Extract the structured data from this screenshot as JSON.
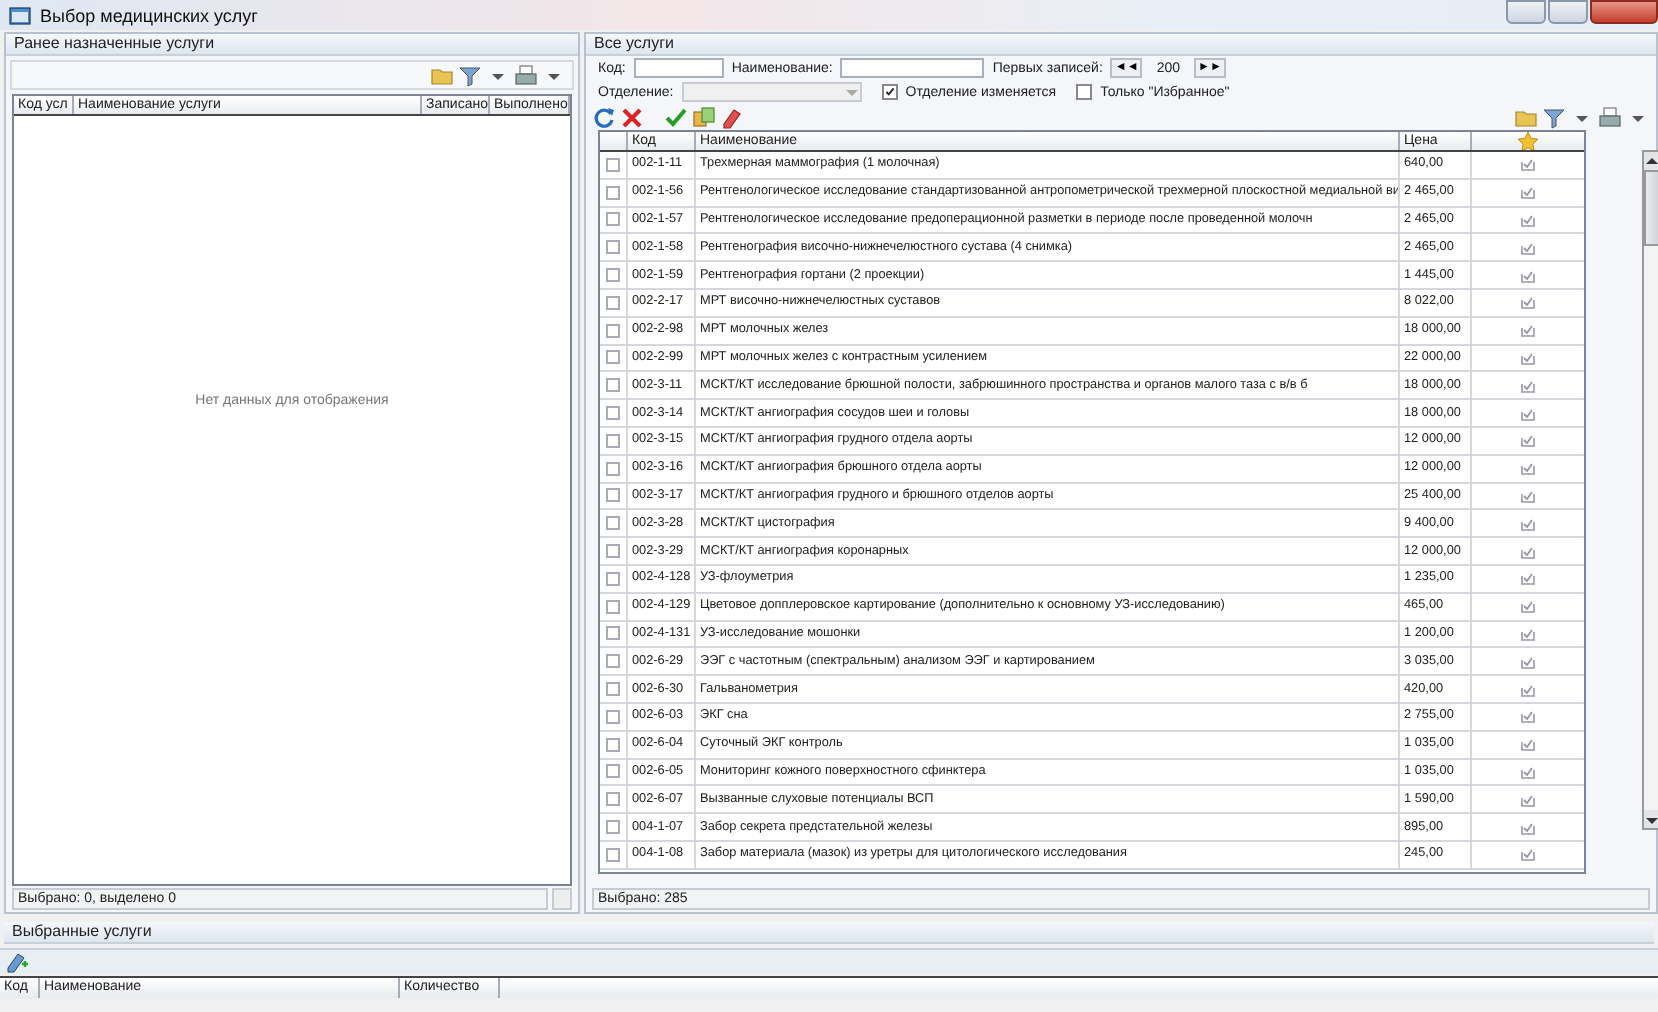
{
  "window": {
    "title": "Выбор медицинских услуг"
  },
  "left_panel": {
    "title": "Ранее назначенные услуги",
    "columns": [
      "Код усл",
      "Наименование услуги",
      "Записано",
      "Выполнено"
    ],
    "empty_text": "Нет данных для отображения",
    "status": "Выбрано: 0, выделено 0"
  },
  "services_panel": {
    "title": "Все услуги",
    "filters": {
      "code_label": "Код:",
      "name_label": "Наименование:",
      "limit_label": "Первых записей:",
      "first_button": "◄◄",
      "limit_value": "200",
      "last_button": "►►",
      "department_label": "Отделение:",
      "department_disabled": true
    },
    "checkboxes": [
      {
        "label": "Отделение изменяется",
        "checked": true
      },
      {
        "label": "Только \"Избранное\"",
        "checked": false
      }
    ],
    "columns": [
      "Код",
      "Наименование",
      "Цена"
    ],
    "rows": [
      {
        "code": "002-1-11",
        "name": "Трехмерная маммография (1 молочная)",
        "price": "640,00",
        "checked": false
      },
      {
        "code": "002-1-56",
        "name": "Рентгенологическое исследование стандартизованной антропометрической трехмерной плоскостной медиальной ви",
        "price": "2 465,00",
        "checked": false
      },
      {
        "code": "002-1-57",
        "name": "Рентгенологическое исследование предоперационной разметки в периоде после проведенной молочн",
        "price": "2 465,00",
        "checked": false
      },
      {
        "code": "002-1-58",
        "name": "Рентгенография височно-нижнечелюстного сустава (4 снимка)",
        "price": "2 465,00",
        "checked": false
      },
      {
        "code": "002-1-59",
        "name": "Рентгенография гортани (2 проекции)",
        "price": "1 445,00",
        "checked": false
      },
      {
        "code": "002-2-17",
        "name": "МРТ височно-нижнечелюстных суставов",
        "price": "8 022,00",
        "checked": false
      },
      {
        "code": "002-2-98",
        "name": "МРТ молочных желез",
        "price": "18 000,00",
        "checked": false
      },
      {
        "code": "002-2-99",
        "name": "МРТ молочных желез с контрастным усилением",
        "price": "22 000,00",
        "checked": false
      },
      {
        "code": "002-3-11",
        "name": "МСКТ/КТ исследование брюшной полости, забрюшинного пространства и органов малого таза с в/в б",
        "price": "18 000,00",
        "checked": false
      },
      {
        "code": "002-3-14",
        "name": "МСКТ/КТ ангиография сосудов шеи и головы",
        "price": "18 000,00",
        "checked": false
      },
      {
        "code": "002-3-15",
        "name": "МСКТ/КТ ангиография грудного отдела аорты",
        "price": "12 000,00",
        "checked": false
      },
      {
        "code": "002-3-16",
        "name": "МСКТ/КТ ангиография брюшного отдела аорты",
        "price": "12 000,00",
        "checked": false
      },
      {
        "code": "002-3-17",
        "name": "МСКТ/КТ ангиография грудного и брюшного отделов аорты",
        "price": "25 400,00",
        "checked": false
      },
      {
        "code": "002-3-28",
        "name": "МСКТ/КТ цистография",
        "price": "9 400,00",
        "checked": false
      },
      {
        "code": "002-3-29",
        "name": "МСКТ/КТ ангиография коронарных",
        "price": "12 000,00",
        "checked": false
      },
      {
        "code": "002-4-128",
        "name": "УЗ-флоуметрия",
        "price": "1 235,00",
        "checked": false
      },
      {
        "code": "002-4-129",
        "name": "Цветовое допплеровское картирование (дополнительно к основному УЗ-исследованию)",
        "price": "465,00",
        "checked": false
      },
      {
        "code": "002-4-131",
        "name": "УЗ-исследование мошонки",
        "price": "1 200,00",
        "checked": false
      },
      {
        "code": "002-6-29",
        "name": "ЭЭГ с частотным (спектральным) анализом ЭЭГ и картированием",
        "price": "3 035,00",
        "checked": false
      },
      {
        "code": "002-6-30",
        "name": "Гальванометрия",
        "price": "420,00",
        "checked": false
      },
      {
        "code": "002-6-03",
        "name": "ЭКГ сна",
        "price": "2 755,00",
        "checked": false
      },
      {
        "code": "002-6-04",
        "name": "Суточный ЭКГ контроль",
        "price": "1 035,00",
        "checked": false
      },
      {
        "code": "002-6-05",
        "name": "Мониторинг кожного поверхностного сфинктера",
        "price": "1 035,00",
        "checked": false
      },
      {
        "code": "002-6-07",
        "name": "Вызванные слуховые потенциалы ВСП",
        "price": "1 590,00",
        "checked": false
      },
      {
        "code": "004-1-07",
        "name": "Забор секрета предстательной железы",
        "price": "895,00",
        "checked": false
      },
      {
        "code": "004-1-08",
        "name": "Забор материала (мазок) из уретры для цитологического исследования",
        "price": "245,00",
        "checked": false
      }
    ],
    "status": "Выбрано: 285"
  },
  "selected_panel": {
    "title": "Выбранные услуги",
    "columns": [
      "Код",
      "Наименование",
      "Количество"
    ]
  }
}
